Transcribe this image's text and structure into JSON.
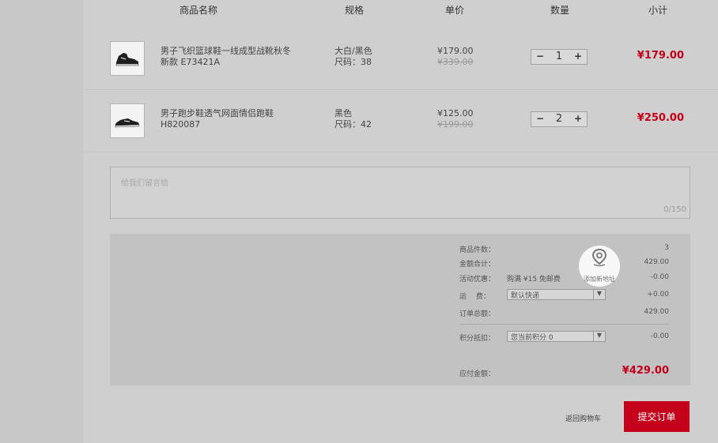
{
  "table_header": {
    "name": "商品名称",
    "spec": "规格",
    "unit_price": "单价",
    "quantity": "数量",
    "subtotal": "小计"
  },
  "items": [
    {
      "name_line1": "男子飞织篮球鞋一线成型战靴秋冬",
      "name_line2": "新款 E73421A",
      "color": "大白/黑色",
      "size": "尺码：38",
      "price": "¥179.00",
      "old_price": "¥339.00",
      "quantity": "1",
      "subtotal": "¥179.00",
      "icon": "high-top-sneaker-icon"
    },
    {
      "name_line1": "男子跑步鞋透气网面情侣跑鞋",
      "name_line2": "H820087",
      "color": "黑色",
      "size": "尺码：42",
      "price": "¥125.00",
      "old_price": "¥199.00",
      "quantity": "2",
      "subtotal": "¥250.00",
      "icon": "running-shoe-icon"
    }
  ],
  "stepper": {
    "minus": "−",
    "plus": "+"
  },
  "comment": {
    "placeholder": "给我们留言给",
    "counter": "0/150"
  },
  "summary": {
    "item_count_label": "商品件数：",
    "item_count_value": "3",
    "amount_label": "金额合计：",
    "amount_value": "429.00",
    "promo_label": "活动优惠：",
    "promo_text": "购满 ¥15 免邮费",
    "promo_value": "-0.00",
    "shipping_label": "运　 费：",
    "shipping_option": "默认快递",
    "shipping_value": "+0.00",
    "order_total_label": "订单总额：",
    "order_total_value": "429.00",
    "points_label": "积分抵扣：",
    "points_option": "您当前积分 0",
    "points_value": "-0.00",
    "payable_label": "应付金额：",
    "payable_value": "¥429.00"
  },
  "address_badge": {
    "label": "添加新地址",
    "icon": "location-pin-icon"
  },
  "footer": {
    "back_link": "返回购物车",
    "submit": "提交订单"
  },
  "colors": {
    "accent": "#c4001a",
    "background": "#cfcfcf"
  }
}
